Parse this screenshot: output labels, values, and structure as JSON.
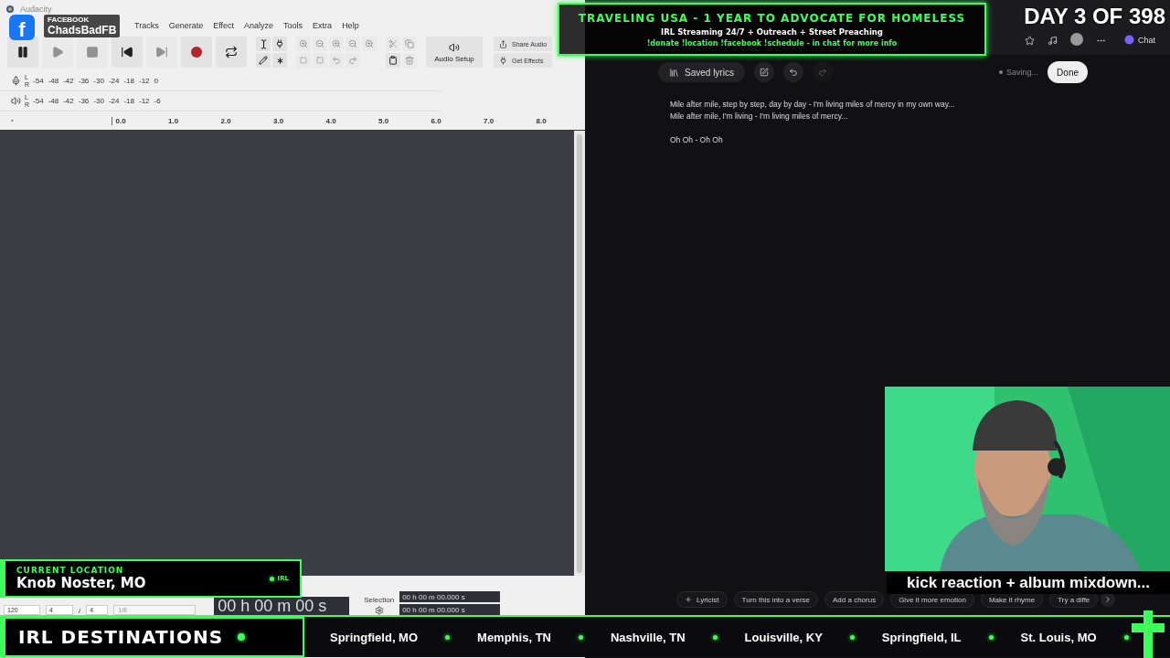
{
  "audacity": {
    "title": "Audacity",
    "menu": [
      "Tracks",
      "Generate",
      "Effect",
      "Analyze",
      "Tools",
      "Extra",
      "Help"
    ],
    "transport": [
      {
        "kind": "pause",
        "disabled": false
      },
      {
        "kind": "play",
        "disabled": true
      },
      {
        "kind": "stop",
        "disabled": true
      },
      {
        "kind": "skip-start",
        "disabled": false
      },
      {
        "kind": "skip-end",
        "disabled": true
      },
      {
        "kind": "record",
        "disabled": false
      },
      {
        "kind": "loop",
        "disabled": false
      }
    ],
    "audio_setup": "Audio Setup",
    "share_audio": "Share Audio",
    "get_effects": "Get Effects",
    "record_meter": {
      "channels": [
        "L",
        "R"
      ],
      "ticks": [
        "-54",
        "-48",
        "-42",
        "-36",
        "-30",
        "-24",
        "-18",
        "-12",
        "0"
      ]
    },
    "playback_meter": {
      "channels": [
        "L",
        "R"
      ],
      "ticks": [
        "-54",
        "-48",
        "-42",
        "-36",
        "-30",
        "-24",
        "-18",
        "-12",
        "-6"
      ]
    },
    "ruler": [
      "0.0",
      "1.0",
      "2.0",
      "3.0",
      "4.0",
      "5.0",
      "6.0",
      "7.0",
      "8.0"
    ],
    "bottom_bar": {
      "tempo": "120",
      "beats": "4",
      "slash": "/",
      "unit": "4",
      "snap": "1/8",
      "time": "00 h 00 m 00 s",
      "selection_label": "Selection",
      "selection_start": "00 h 00 m 00.000 s",
      "selection_end": "00 h 00 m 00.000 s"
    }
  },
  "browser": {
    "chat": "Chat",
    "toolbar": {
      "saved_lyrics": "Saved lyrics",
      "status": "Saving...",
      "done": "Done"
    },
    "lyrics": [
      [
        "Mile after mile, step by step, day by day - I'm living miles of mercy in my own way...",
        "Mile after mile, I'm living - I'm living miles of mercy..."
      ],
      [
        "Oh Oh - Oh Oh"
      ]
    ],
    "chips": [
      {
        "label": "Lyricist",
        "kind": "add"
      },
      {
        "label": "Turn this into a verse",
        "kind": "prompt"
      },
      {
        "label": "Add a chorus",
        "kind": "prompt"
      },
      {
        "label": "Give it more emotion",
        "kind": "prompt"
      },
      {
        "label": "Make it rhyme",
        "kind": "prompt"
      },
      {
        "label": "Try a diffe",
        "kind": "prompt"
      }
    ]
  },
  "overlays": {
    "facebook": {
      "logo": "f",
      "label": "FACEBOOK",
      "handle": "ChadsBadFB"
    },
    "banner": {
      "title": "TRAVELING USA - 1 YEAR TO ADVOCATE FOR HOMELESS",
      "subtitle": "IRL Streaming 24/7 + Outreach + Street Preaching",
      "commands": "!donate !location !facebook !schedule - in chat for more info"
    },
    "day_counter": "DAY 3 OF 398",
    "location": {
      "label": "CURRENT LOCATION",
      "place": "Knob Noster, MO",
      "tag": "IRL"
    },
    "webcam": {
      "kind": "picture",
      "caption": "kick reaction + album mixdown..."
    },
    "destinations": {
      "title": "IRL DESTINATIONS",
      "cities": [
        "Springfield, MO",
        "Memphis, TN",
        "Nashville, TN",
        "Louisville, KY",
        "Springfield, IL",
        "St. Louis, MO"
      ]
    }
  }
}
